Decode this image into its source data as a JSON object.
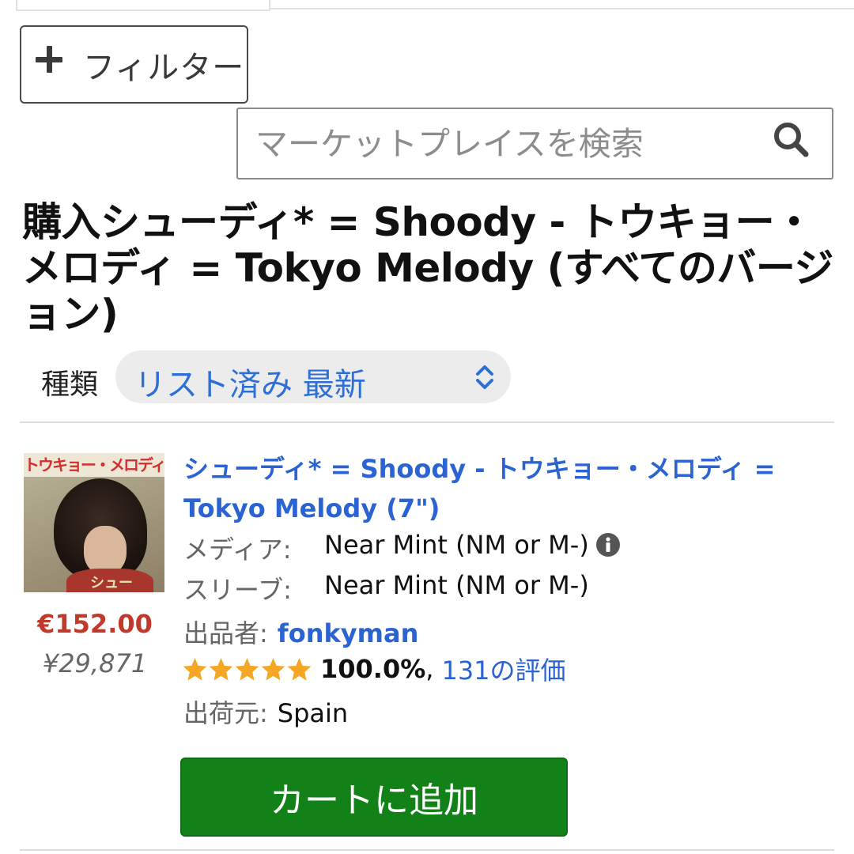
{
  "filter": {
    "label": "フィルター"
  },
  "search": {
    "placeholder": "マーケットプレイスを検索"
  },
  "title": "購入シューディ* = Shoody - トウキョー・メロディ = Tokyo Melody (すべてのバージョン)",
  "sort": {
    "label": "種類",
    "value": "リスト済み 最新"
  },
  "listing": {
    "cover_text": "トウキョー・メロディー",
    "cover_sticker": "シュー",
    "title": "シューディ* = Shoody - トウキョー・メロディ = Tokyo Melody (7\")",
    "media_label": "メディア:",
    "media_value": "Near Mint (NM or M-)",
    "sleeve_label": "スリーブ:",
    "sleeve_value": "Near Mint (NM or M-)",
    "seller_label": "出品者:",
    "seller_name": "fonkyman",
    "rating_stars": 5,
    "rating_percent": "100.0%",
    "rating_comma": ",",
    "reviews": "131の評価",
    "ships_label": "出荷元:",
    "ships_from": "Spain",
    "price_eur": "€152.00",
    "price_jpy": "¥29,871",
    "cart_label": "カートに追加"
  },
  "colors": {
    "link": "#2c63d2",
    "price": "#c0392b",
    "cart": "#128218",
    "star": "#f5a623"
  }
}
